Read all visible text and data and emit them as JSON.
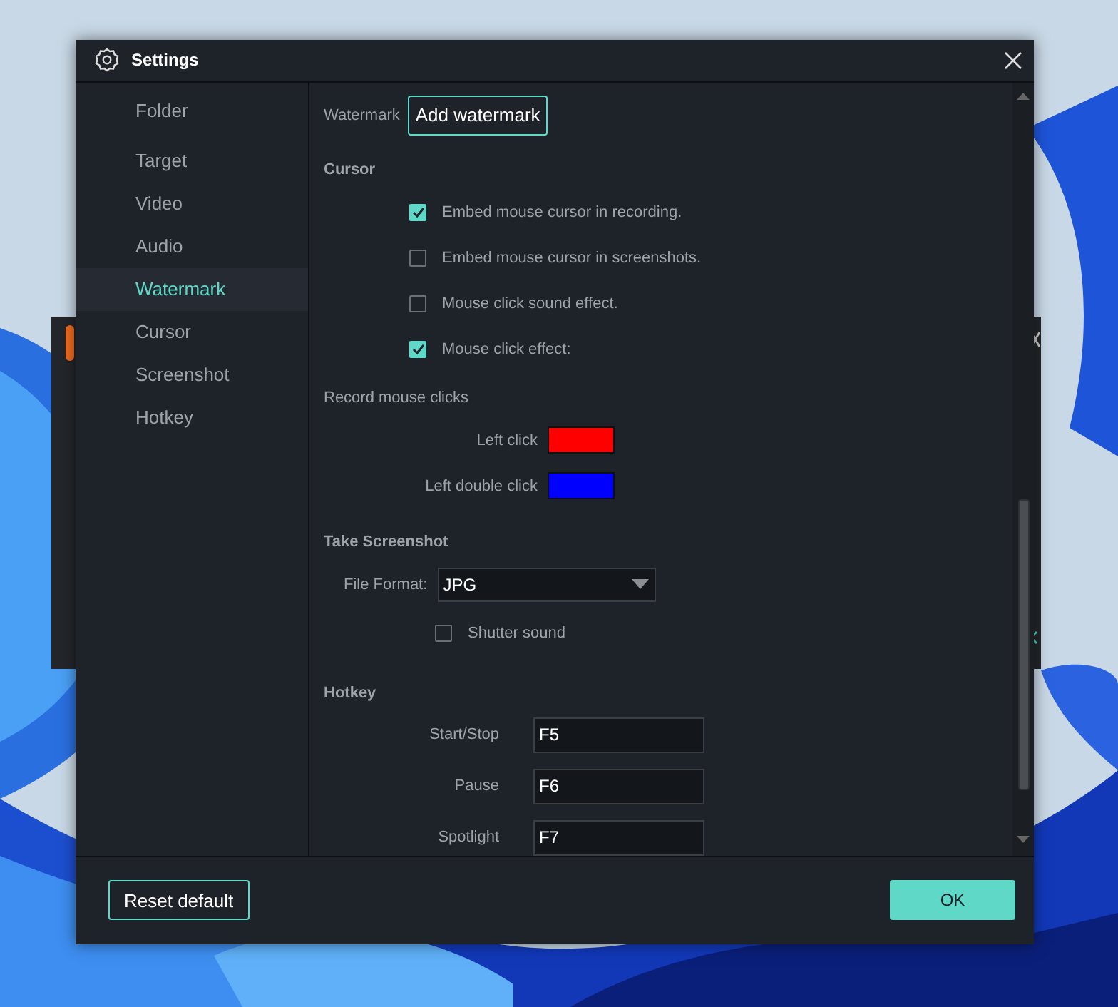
{
  "window": {
    "title": "Settings"
  },
  "sidebar": {
    "items": [
      {
        "label": "Folder",
        "selected": false
      },
      {
        "label": "Target",
        "selected": false
      },
      {
        "label": "Video",
        "selected": false
      },
      {
        "label": "Audio",
        "selected": false
      },
      {
        "label": "Watermark",
        "selected": true
      },
      {
        "label": "Cursor",
        "selected": false
      },
      {
        "label": "Screenshot",
        "selected": false
      },
      {
        "label": "Hotkey",
        "selected": false
      }
    ]
  },
  "watermark": {
    "label": "Watermark",
    "button": "Add watermark"
  },
  "cursor": {
    "heading": "Cursor",
    "options": [
      {
        "label": "Embed mouse cursor in recording.",
        "checked": true
      },
      {
        "label": "Embed mouse cursor in screenshots.",
        "checked": false
      },
      {
        "label": "Mouse click sound effect.",
        "checked": false
      },
      {
        "label": "Mouse click effect:",
        "checked": true
      }
    ]
  },
  "record_mouse_clicks": {
    "label": "Record mouse clicks",
    "clicks": [
      {
        "label": "Left click",
        "color": "#ff0000"
      },
      {
        "label": "Left double click",
        "color": "#0000ff"
      }
    ]
  },
  "take_screenshot": {
    "heading": "Take Screenshot",
    "file_format": {
      "label": "File Format:",
      "value": "JPG"
    },
    "shutter_sound": {
      "label": "Shutter sound",
      "checked": false
    }
  },
  "hotkey": {
    "heading": "Hotkey",
    "keys": [
      {
        "label": "Start/Stop",
        "value": "F5"
      },
      {
        "label": "Pause",
        "value": "F6"
      },
      {
        "label": "Spotlight",
        "value": "F7"
      }
    ]
  },
  "buttons": {
    "reset": "Reset default",
    "ok": "OK"
  }
}
